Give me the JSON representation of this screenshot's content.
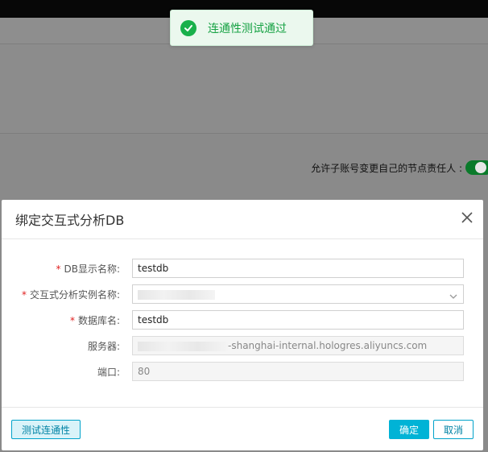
{
  "toast": {
    "message": "连通性测试通过",
    "icon": "check-circle-icon",
    "color": "#19b04b"
  },
  "background": {
    "allow_label": "允许子账号变更自己的节点责任人 :"
  },
  "dialog": {
    "title": "绑定交互式分析DB",
    "fields": {
      "db_display_name": {
        "label": "DB显示名称:",
        "value": "testdb",
        "required": true
      },
      "instance_name": {
        "label": "交互式分析实例名称:",
        "value": "",
        "required": true
      },
      "database_name": {
        "label": "数据库名:",
        "value": "testdb",
        "required": true
      },
      "server": {
        "label": "服务器:",
        "value_suffix": "-shanghai-internal.hologres.aliyuncs.com"
      },
      "port": {
        "label": "端口:",
        "value": "80"
      }
    },
    "buttons": {
      "test": "测试连通性",
      "ok": "确定",
      "cancel": "取消"
    },
    "accent_color": "#00b3d6"
  }
}
